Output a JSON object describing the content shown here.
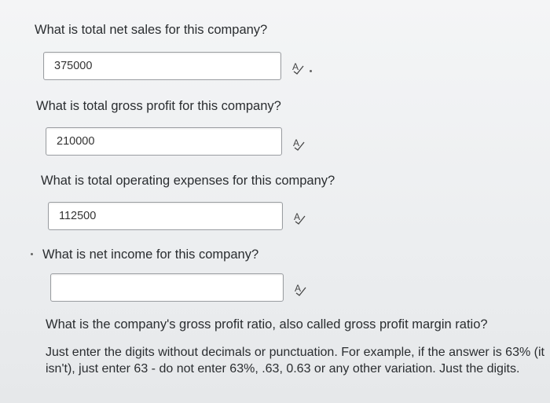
{
  "questions": [
    {
      "text": "What is total net sales for this company?",
      "value": "375000"
    },
    {
      "text": "What is total gross profit for this company?",
      "value": "210000"
    },
    {
      "text": "What is total operating expenses for this company?",
      "value": "112500"
    },
    {
      "text": "What is net income for this company?",
      "value": ""
    }
  ],
  "final_question": {
    "text": "What is the company's gross profit ratio, also called gross profit margin ratio?",
    "instructions": "Just enter the digits without decimals or punctuation. For example, if the answer is 63% (it isn't), just enter 63 - do not enter 63%, .63, 0.63 or any other variation. Just the digits."
  },
  "icons": {
    "spellcheck": "spellcheck-icon"
  }
}
